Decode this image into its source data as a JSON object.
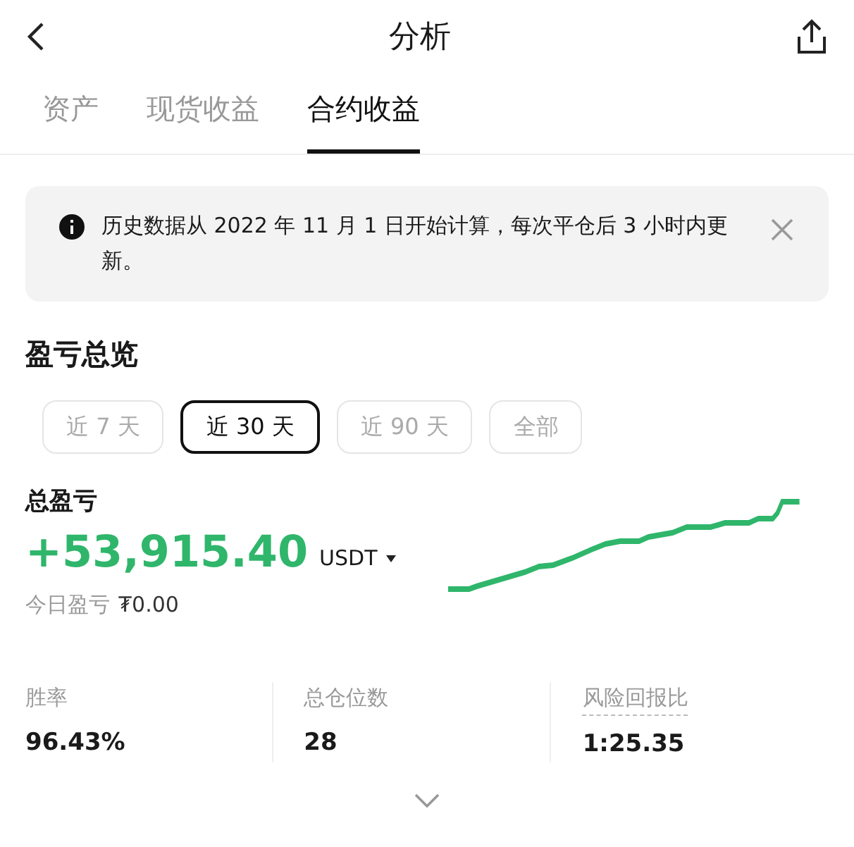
{
  "header": {
    "title": "分析"
  },
  "tabs": [
    {
      "label": "资产",
      "selected": false
    },
    {
      "label": "现货收益",
      "selected": false
    },
    {
      "label": "合约收益",
      "selected": true
    }
  ],
  "notice": {
    "text": "历史数据从 2022 年 11 月 1 日开始计算，每次平仓后 3 小时内更新。"
  },
  "overview": {
    "heading": "盈亏总览",
    "periods": [
      {
        "label": "近 7 天",
        "selected": false
      },
      {
        "label": "近 30 天",
        "selected": true
      },
      {
        "label": "近 90 天",
        "selected": false
      },
      {
        "label": "全部",
        "selected": false
      }
    ],
    "total_label": "总盈亏",
    "total_value": "+53,915.40",
    "currency": "USDT",
    "today_label": "今日盈亏",
    "today_value": "₮0.00"
  },
  "stats": [
    {
      "label": "胜率",
      "value": "96.43%",
      "kind": "plain"
    },
    {
      "label": "总仓位数",
      "value": "28",
      "kind": "plain"
    },
    {
      "label": "风险回报比",
      "value": "1:25.35",
      "kind": "hint"
    }
  ]
}
